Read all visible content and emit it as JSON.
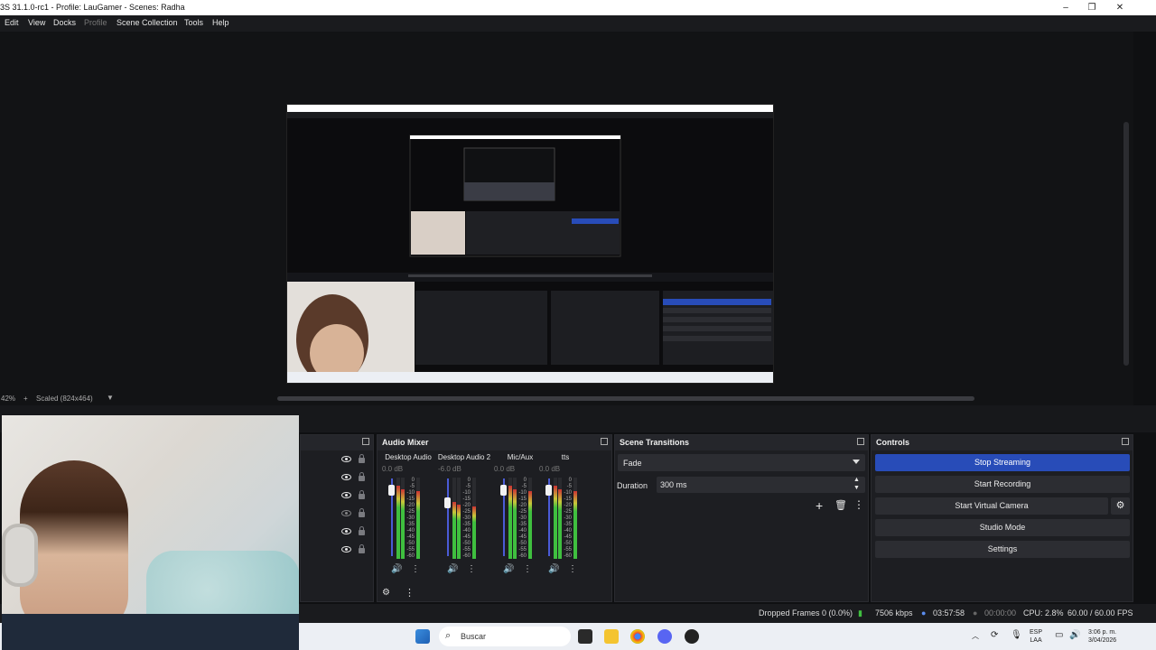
{
  "window": {
    "title": "3S 31.1.0-rc1 - Profile: LauGamer - Scenes: Radha",
    "controls": [
      "–",
      "❐",
      "✕"
    ]
  },
  "menu": [
    "Edit",
    "View",
    "Docks",
    "Profile",
    "Scene Collection",
    "Tools",
    "Help"
  ],
  "preview": {
    "zoom": "42%",
    "scale_mode": "Scaled (824x464)"
  },
  "docks": {
    "audio_mixer": {
      "title": "Audio Mixer",
      "channels": [
        {
          "name": "Desktop Audio",
          "db": "0.0 dB",
          "level": 0.9
        },
        {
          "name": "Desktop Audio 2",
          "db": "-6.0 dB",
          "level": 0.7
        },
        {
          "name": "Mic/Aux",
          "db": "0.0 dB",
          "level": 0.9
        },
        {
          "name": "tts",
          "db": "0.0 dB",
          "level": 0.9
        }
      ],
      "scale": [
        "0",
        "-5",
        "-10",
        "-15",
        "-20",
        "-25",
        "-30",
        "-35",
        "-40",
        "-45",
        "-50",
        "-55",
        "-60"
      ]
    },
    "scene_transitions": {
      "title": "Scene Transitions",
      "transition": "Fade",
      "duration_label": "Duration",
      "duration_value": "300 ms"
    },
    "controls": {
      "title": "Controls",
      "stop_streaming": "Stop Streaming",
      "start_recording": "Start Recording",
      "start_virtual_camera": "Start Virtual Camera",
      "studio_mode": "Studio Mode",
      "settings": "Settings"
    }
  },
  "status": {
    "dropped_frames": "Dropped Frames 0 (0.0%)",
    "bitrate": "7506 kbps",
    "stream_time": "03:57:58",
    "record_time": "00:00:00",
    "cpu": "CPU: 2.8%",
    "fps": "60.00 / 60.00 FPS"
  },
  "taskbar": {
    "search_placeholder": "Buscar",
    "lang_top": "ESP",
    "lang_bottom": "LAA",
    "time": "3:06 p. m.",
    "date": "3/04/2026"
  },
  "colors": {
    "accent": "#284cb8",
    "panel": "#1d1e22",
    "background": "#0f1012"
  }
}
